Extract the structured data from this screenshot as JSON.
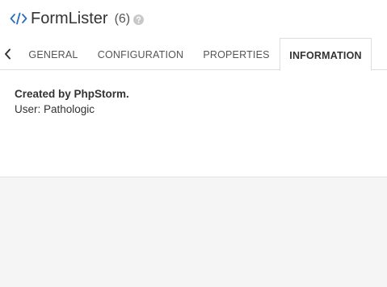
{
  "header": {
    "title": "FormLister",
    "count": "(6)",
    "code_icon": "code-icon",
    "help_icon": "question-circle-icon"
  },
  "tabs": [
    {
      "label": "GENERAL",
      "active": false
    },
    {
      "label": "CONFIGURATION",
      "active": false
    },
    {
      "label": "PROPERTIES",
      "active": false
    },
    {
      "label": "INFORMATION",
      "active": true
    }
  ],
  "information": {
    "heading": "Created by PhpStorm.",
    "user": "User: Pathologic"
  },
  "colors": {
    "icon_blue": "#2a6ebb",
    "help_gray": "#c8c8c8",
    "page_bg": "#f5f5f5"
  }
}
